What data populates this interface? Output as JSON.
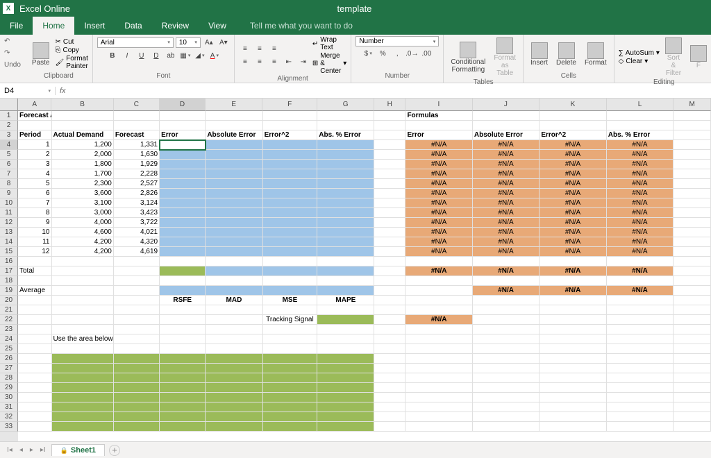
{
  "app": {
    "name": "Excel Online",
    "document": "template"
  },
  "menu": {
    "tabs": [
      "File",
      "Home",
      "Insert",
      "Data",
      "Review",
      "View"
    ],
    "active": 1,
    "tellme": "Tell me what you want to do"
  },
  "ribbon": {
    "undo": "Undo",
    "clipboard": {
      "paste": "Paste",
      "cut": "Cut",
      "copy": "Copy",
      "formatPainter": "Format Painter",
      "label": "Clipboard"
    },
    "font": {
      "name": "Arial",
      "size": "10",
      "label": "Font"
    },
    "alignment": {
      "wrap": "Wrap Text",
      "merge": "Merge & Center",
      "label": "Alignment"
    },
    "number": {
      "format": "Number",
      "label": "Number"
    },
    "tables": {
      "conditional": "Conditional Formatting",
      "formatTable": "Format as Table",
      "label": "Tables"
    },
    "cells": {
      "insert": "Insert",
      "delete": "Delete",
      "format": "Format",
      "label": "Cells"
    },
    "editing": {
      "autosum": "AutoSum",
      "clear": "Clear",
      "sort": "Sort & Filter",
      "label": "Editing"
    }
  },
  "formulaBar": {
    "cellRef": "D4",
    "fx": "fx",
    "value": ""
  },
  "columns": [
    "A",
    "B",
    "C",
    "D",
    "E",
    "F",
    "G",
    "H",
    "I",
    "J",
    "K",
    "L",
    "M"
  ],
  "activeCol": "D",
  "activeRow": 4,
  "sheet": {
    "title": "Forecast Accuracy Measures",
    "formulasTitle": "Formulas",
    "headers": {
      "period": "Period",
      "actual": "Actual Demand",
      "forecast": "Forecast",
      "error": "Error",
      "absError": "Absolute Error",
      "error2": "Error^2",
      "absPctError": "Abs. % Error"
    },
    "data": [
      {
        "period": "1",
        "actual": "1,200",
        "forecast": "1,331"
      },
      {
        "period": "2",
        "actual": "2,000",
        "forecast": "1,630"
      },
      {
        "period": "3",
        "actual": "1,800",
        "forecast": "1,929"
      },
      {
        "period": "4",
        "actual": "1,700",
        "forecast": "2,228"
      },
      {
        "period": "5",
        "actual": "2,300",
        "forecast": "2,527"
      },
      {
        "period": "6",
        "actual": "3,600",
        "forecast": "2,826"
      },
      {
        "period": "7",
        "actual": "3,100",
        "forecast": "3,124"
      },
      {
        "period": "8",
        "actual": "3,000",
        "forecast": "3,423"
      },
      {
        "period": "9",
        "actual": "4,000",
        "forecast": "3,722"
      },
      {
        "period": "10",
        "actual": "4,600",
        "forecast": "4,021"
      },
      {
        "period": "11",
        "actual": "4,200",
        "forecast": "4,320"
      },
      {
        "period": "12",
        "actual": "4,200",
        "forecast": "4,619"
      }
    ],
    "na": "#N/A",
    "total": "Total",
    "average": "Average",
    "rsfe": "RSFE",
    "mad": "MAD",
    "mse": "MSE",
    "mape": "MAPE",
    "tracking": "Tracking Signal",
    "chartNote": "Use the area below to draw a line chart for the forecast."
  },
  "sheetTab": {
    "name": "Sheet1"
  }
}
